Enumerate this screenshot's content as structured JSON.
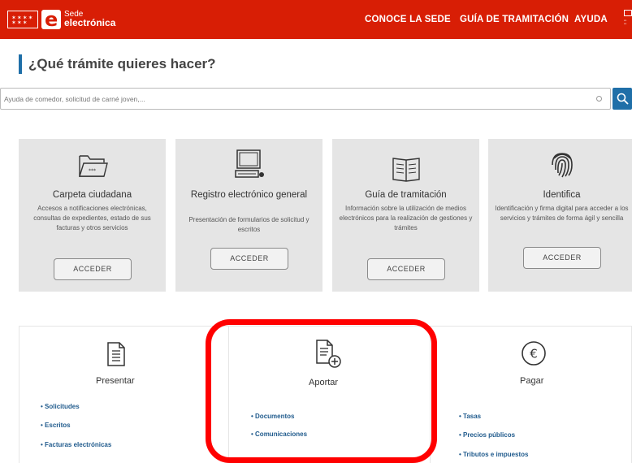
{
  "header": {
    "logo_line1": "Sede",
    "logo_line2": "electrónica",
    "nav": [
      "CONOCE LA SEDE",
      "GUÍA DE TRAMITACIÓN",
      "AYUDA"
    ],
    "brand_color": "#d81e05"
  },
  "search": {
    "title": "¿Qué trámite quieres hacer?",
    "placeholder": "Ayuda de comedor, solicitud de carné joven,...",
    "button_icon": "search-icon",
    "accent_color": "#1f6fa8"
  },
  "cards": [
    {
      "icon": "folder-icon",
      "title": "Carpeta ciudadana",
      "description": "Accesos a notificaciones electrónicas, consultas de expedientes, estado de sus facturas y otros servicios",
      "button": "ACCEDER"
    },
    {
      "icon": "computer-icon",
      "title": "Registro electrónico general",
      "description": "Presentación de formularios de solicitud y escritos",
      "button": "ACCEDER"
    },
    {
      "icon": "book-icon",
      "title": "Guía de tramitación",
      "description": "Información sobre la utilización de medios electrónicos para la realización de gestiones y trámites",
      "button": "ACCEDER"
    },
    {
      "icon": "fingerprint-icon",
      "title": "Identifica",
      "description": "Identificación y firma digital para acceder a los servicios y trámites de forma ágil y sencilla",
      "button": "ACCEDER"
    }
  ],
  "sections": [
    {
      "icon": "document-icon",
      "title": "Presentar",
      "items": [
        "Solicitudes",
        "Escritos",
        "Facturas electrónicas"
      ]
    },
    {
      "icon": "document-add-icon",
      "title": "Aportar",
      "items": [
        "Documentos",
        "Comunicaciones"
      ]
    },
    {
      "icon": "euro-icon",
      "title": "Pagar",
      "items": [
        "Tasas",
        "Precios públicos",
        "Tributos e impuestos"
      ]
    }
  ],
  "highlight_color": "#ff0000"
}
